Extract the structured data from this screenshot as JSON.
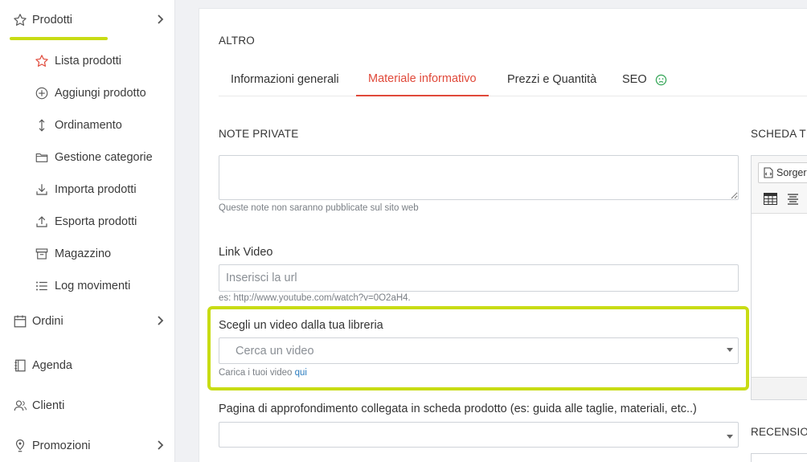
{
  "sidebar": {
    "main": {
      "label": "Prodotti",
      "icon": "star-icon"
    },
    "sub_items": [
      {
        "label": "Lista prodotti",
        "icon": "star-outline-red-icon"
      },
      {
        "label": "Aggiungi prodotto",
        "icon": "plus-circle-icon"
      },
      {
        "label": "Ordinamento",
        "icon": "up-down-arrow-icon"
      },
      {
        "label": "Gestione categorie",
        "icon": "folder-icon"
      },
      {
        "label": "Importa prodotti",
        "icon": "download-icon"
      },
      {
        "label": "Esporta prodotti",
        "icon": "upload-icon"
      },
      {
        "label": "Magazzino",
        "icon": "archive-box-icon"
      },
      {
        "label": "Log movimenti",
        "icon": "list-icon"
      }
    ],
    "sections": [
      {
        "label": "Ordini",
        "icon": "calendar-icon"
      },
      {
        "label": "Agenda",
        "icon": "book-icon"
      },
      {
        "label": "Clienti",
        "icon": "users-icon"
      },
      {
        "label": "Promozioni",
        "icon": "pin-icon"
      }
    ],
    "accent_color": "#c8dc14"
  },
  "main": {
    "section_title": "ALTRO",
    "tabs": [
      {
        "label": "Informazioni generali"
      },
      {
        "label": "Materiale informativo"
      },
      {
        "label": "Prezzi e Quantità"
      },
      {
        "label": "SEO"
      }
    ],
    "active_tab_color": "#e0493a",
    "notes": {
      "label": "NOTE PRIVATE",
      "hint": "Queste note non saranno pubblicate sul sito web",
      "value": ""
    },
    "video_link": {
      "label": "Link Video",
      "placeholder": "Inserisci la url",
      "hint": "es: http://www.youtube.com/watch?v=0O2aH4."
    },
    "video_library": {
      "label": "Scegli un video dalla tua libreria",
      "placeholder": "Cerca un video",
      "hint_prefix": "Carica i tuoi video",
      "hint_link": "qui"
    },
    "related_page": {
      "label": "Pagina di approfondimento collegata in scheda prodotto (es: guida alle taglie, materiali, etc..)"
    }
  },
  "right": {
    "scheda_label": "SCHEDA TE",
    "source_button": "Sorger",
    "recensioni_label": "RECENSIO"
  }
}
